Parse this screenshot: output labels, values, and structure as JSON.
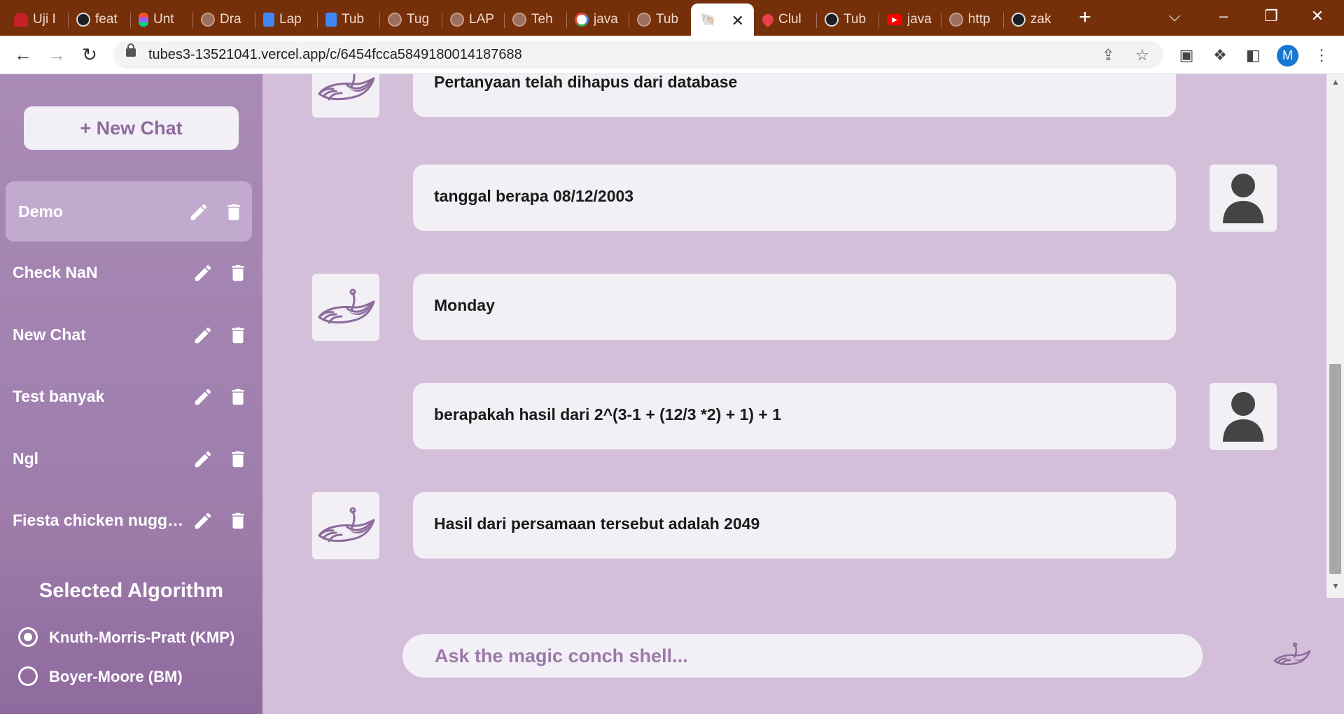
{
  "browser": {
    "tabs": [
      {
        "title": "Uji I",
        "favicon": "red-icon"
      },
      {
        "title": "feat",
        "favicon": "github-icon"
      },
      {
        "title": "Unt",
        "favicon": "figma-icon"
      },
      {
        "title": "Dra",
        "favicon": "globe-icon"
      },
      {
        "title": "Lap",
        "favicon": "docs-icon"
      },
      {
        "title": "Tub",
        "favicon": "docs-icon"
      },
      {
        "title": "Tug",
        "favicon": "globe-icon"
      },
      {
        "title": "LAP",
        "favicon": "globe-icon"
      },
      {
        "title": "Teh",
        "favicon": "globe-icon"
      },
      {
        "title": "java",
        "favicon": "google-icon"
      },
      {
        "title": "Tub",
        "favicon": "globe-icon"
      },
      {
        "title": "",
        "favicon": "conch-icon",
        "active": true
      },
      {
        "title": "Clul",
        "favicon": "fire-icon"
      },
      {
        "title": "Tub",
        "favicon": "github-icon"
      },
      {
        "title": "java",
        "favicon": "youtube-icon"
      },
      {
        "title": "http",
        "favicon": "globe-icon"
      },
      {
        "title": "zak",
        "favicon": "github-icon"
      }
    ],
    "url": "tubes3-13521041.vercel.app/c/6454fcca5849180014187688",
    "profile_initial": "M"
  },
  "sidebar": {
    "new_chat_label": "+ New Chat",
    "chats": [
      {
        "label": "Demo",
        "active": true
      },
      {
        "label": "Check NaN"
      },
      {
        "label": "New Chat"
      },
      {
        "label": "Test banyak"
      },
      {
        "label": "Ngl"
      },
      {
        "label": "Fiesta chicken nuggets"
      }
    ]
  },
  "algorithm": {
    "title": "Selected Algorithm",
    "options": [
      {
        "label": "Knuth-Morris-Pratt (KMP)",
        "selected": true
      },
      {
        "label": "Boyer-Moore (BM)",
        "selected": false
      }
    ]
  },
  "messages": [
    {
      "sender": "bot",
      "text": "Pertanyaan telah dihapus dari database"
    },
    {
      "sender": "user",
      "text": "tanggal berapa 08/12/2003"
    },
    {
      "sender": "bot",
      "text": "Monday"
    },
    {
      "sender": "user",
      "text": "berapakah hasil dari 2^(3-1 + (12/3 *2) + 1) + 1"
    },
    {
      "sender": "bot",
      "text": "Hasil dari persamaan tersebut adalah 2049"
    }
  ],
  "input": {
    "placeholder": "Ask the magic conch shell...",
    "value": ""
  },
  "colors": {
    "accent": "#8d6b9c",
    "background": "#d3bfd9",
    "sidebar": "#a98bb6",
    "bubble": "#f2eff5",
    "tabstrip": "#75300a"
  }
}
